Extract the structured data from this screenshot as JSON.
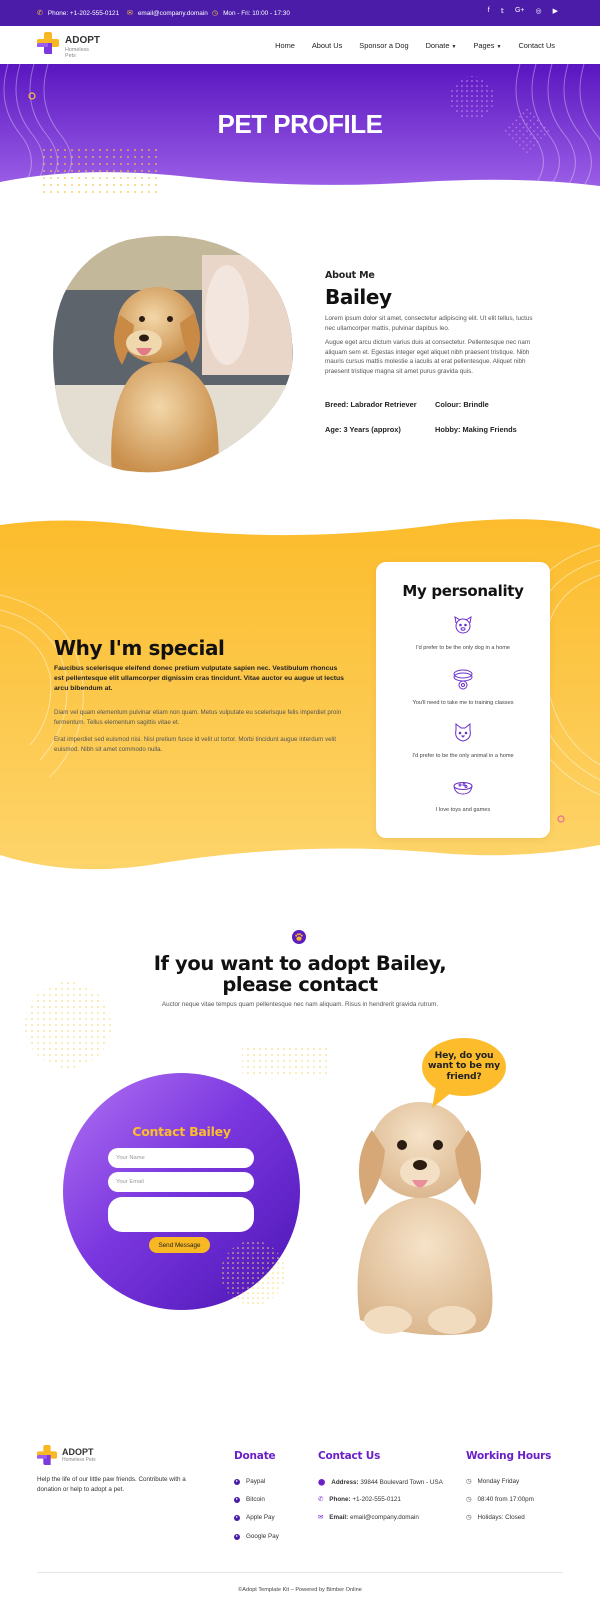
{
  "topbar": {
    "phone": "Phone: +1-202-555-0121",
    "email": "email@company.domain",
    "hours": "Mon - Fri: 10:00 - 17:30",
    "social_icons": [
      "facebook-icon",
      "twitter-icon",
      "google-plus-icon",
      "instagram-icon",
      "youtube-icon"
    ]
  },
  "brand": {
    "name": "ADOPT",
    "tagline": "Homeless Pets"
  },
  "nav": {
    "items": [
      {
        "label": "Home"
      },
      {
        "label": "About Us"
      },
      {
        "label": "Sponsor a Dog"
      },
      {
        "label": "Donate"
      },
      {
        "label": "Pages"
      },
      {
        "label": "Contact Us"
      }
    ]
  },
  "hero": {
    "title": "PET PROFILE"
  },
  "profile": {
    "about_label": "About Me",
    "name": "Bailey",
    "para1": "Lorem ipsum dolor sit amet, consectetur adipiscing elit. Ut elit tellus, luctus nec ullamcorper mattis, pulvinar dapibus leo.",
    "para2": "Augue eget arcu dictum varius duis at consectetur. Pellentesque nec nam aliquam sem et. Egestas integer eget aliquet nibh praesent tristique. Nibh mauris cursus mattis molestie a iaculis at erat pellentesque. Aliquet nibh praesent tristique magna sit amet purus gravida quis.",
    "breed": "Breed: Labrador Retriever",
    "colour": "Colour: Brindle",
    "age": "Age: 3 Years (approx)",
    "hobby": "Hobby: Making Friends"
  },
  "special": {
    "title": "Why I'm special",
    "lead": "Faucibus scelerisque eleifend donec pretium vulputate sapien nec. Vestibulum rhoncus est pellentesque elit ullamcorper dignissim cras tincidunt. Vitae auctor eu augue ut lectus arcu bibendum at.",
    "para1": "Diam vel quam elementum pulvinar etiam non quam. Metus vulputate eu scelerisque felis imperdiet proin fermentum. Tellus elementum sagittis vitae et.",
    "para2": "Erat imperdiet sed euismod nisi. Nisl pretium fusce id velit ut tortor. Morbi tincidunt augue interdum velit euismod. Nibh sit amet commodo nulla."
  },
  "personality": {
    "title": "My personality",
    "traits": [
      {
        "icon": "dog-face-icon",
        "text": "I'd prefer to be the only dog in a home"
      },
      {
        "icon": "dog-collar-icon",
        "text": "You'll need to take me to training classes"
      },
      {
        "icon": "cat-face-icon",
        "text": "I'd prefer to be the only animal in a home"
      },
      {
        "icon": "pet-bowl-icon",
        "text": "I love toys and games"
      }
    ]
  },
  "adopt": {
    "title": "If you want to adopt Bailey, please contact",
    "subtitle": "Auctor neque vitae tempus quam pellentesque nec nam aliquam. Risus in hendrerit gravida rutrum.",
    "speech": "Hey, do you want to be my friend?"
  },
  "form": {
    "title": "Contact Bailey",
    "name_placeholder": "Your Name",
    "email_placeholder": "Your Email",
    "send_label": "Send Message"
  },
  "footer": {
    "description": "Help the life of our little paw friends. Contribute with a donation or help to adopt a pet.",
    "donate": {
      "title": "Donate",
      "items": [
        "Paypal",
        "Bitcoin",
        "Apple Pay",
        "Google Pay"
      ]
    },
    "contact": {
      "title": "Contact Us",
      "address_label": "Address:",
      "address": "39844 Boulevard Town - USA",
      "phone_label": "Phone:",
      "phone": "+1-202-555-0121",
      "email_label": "Email:",
      "email": "email@company.domain"
    },
    "hours": {
      "title": "Working Hours",
      "items": [
        "Monday Friday",
        "08:40 from 17:00pm",
        "Holidays: Closed"
      ]
    },
    "copyright": "©Adopt Template Kit – Powered by Bimber Online"
  },
  "colors": {
    "purple": "#4a1ca8",
    "accent_purple": "#6a1fc7",
    "yellow": "#fcbc2c"
  }
}
